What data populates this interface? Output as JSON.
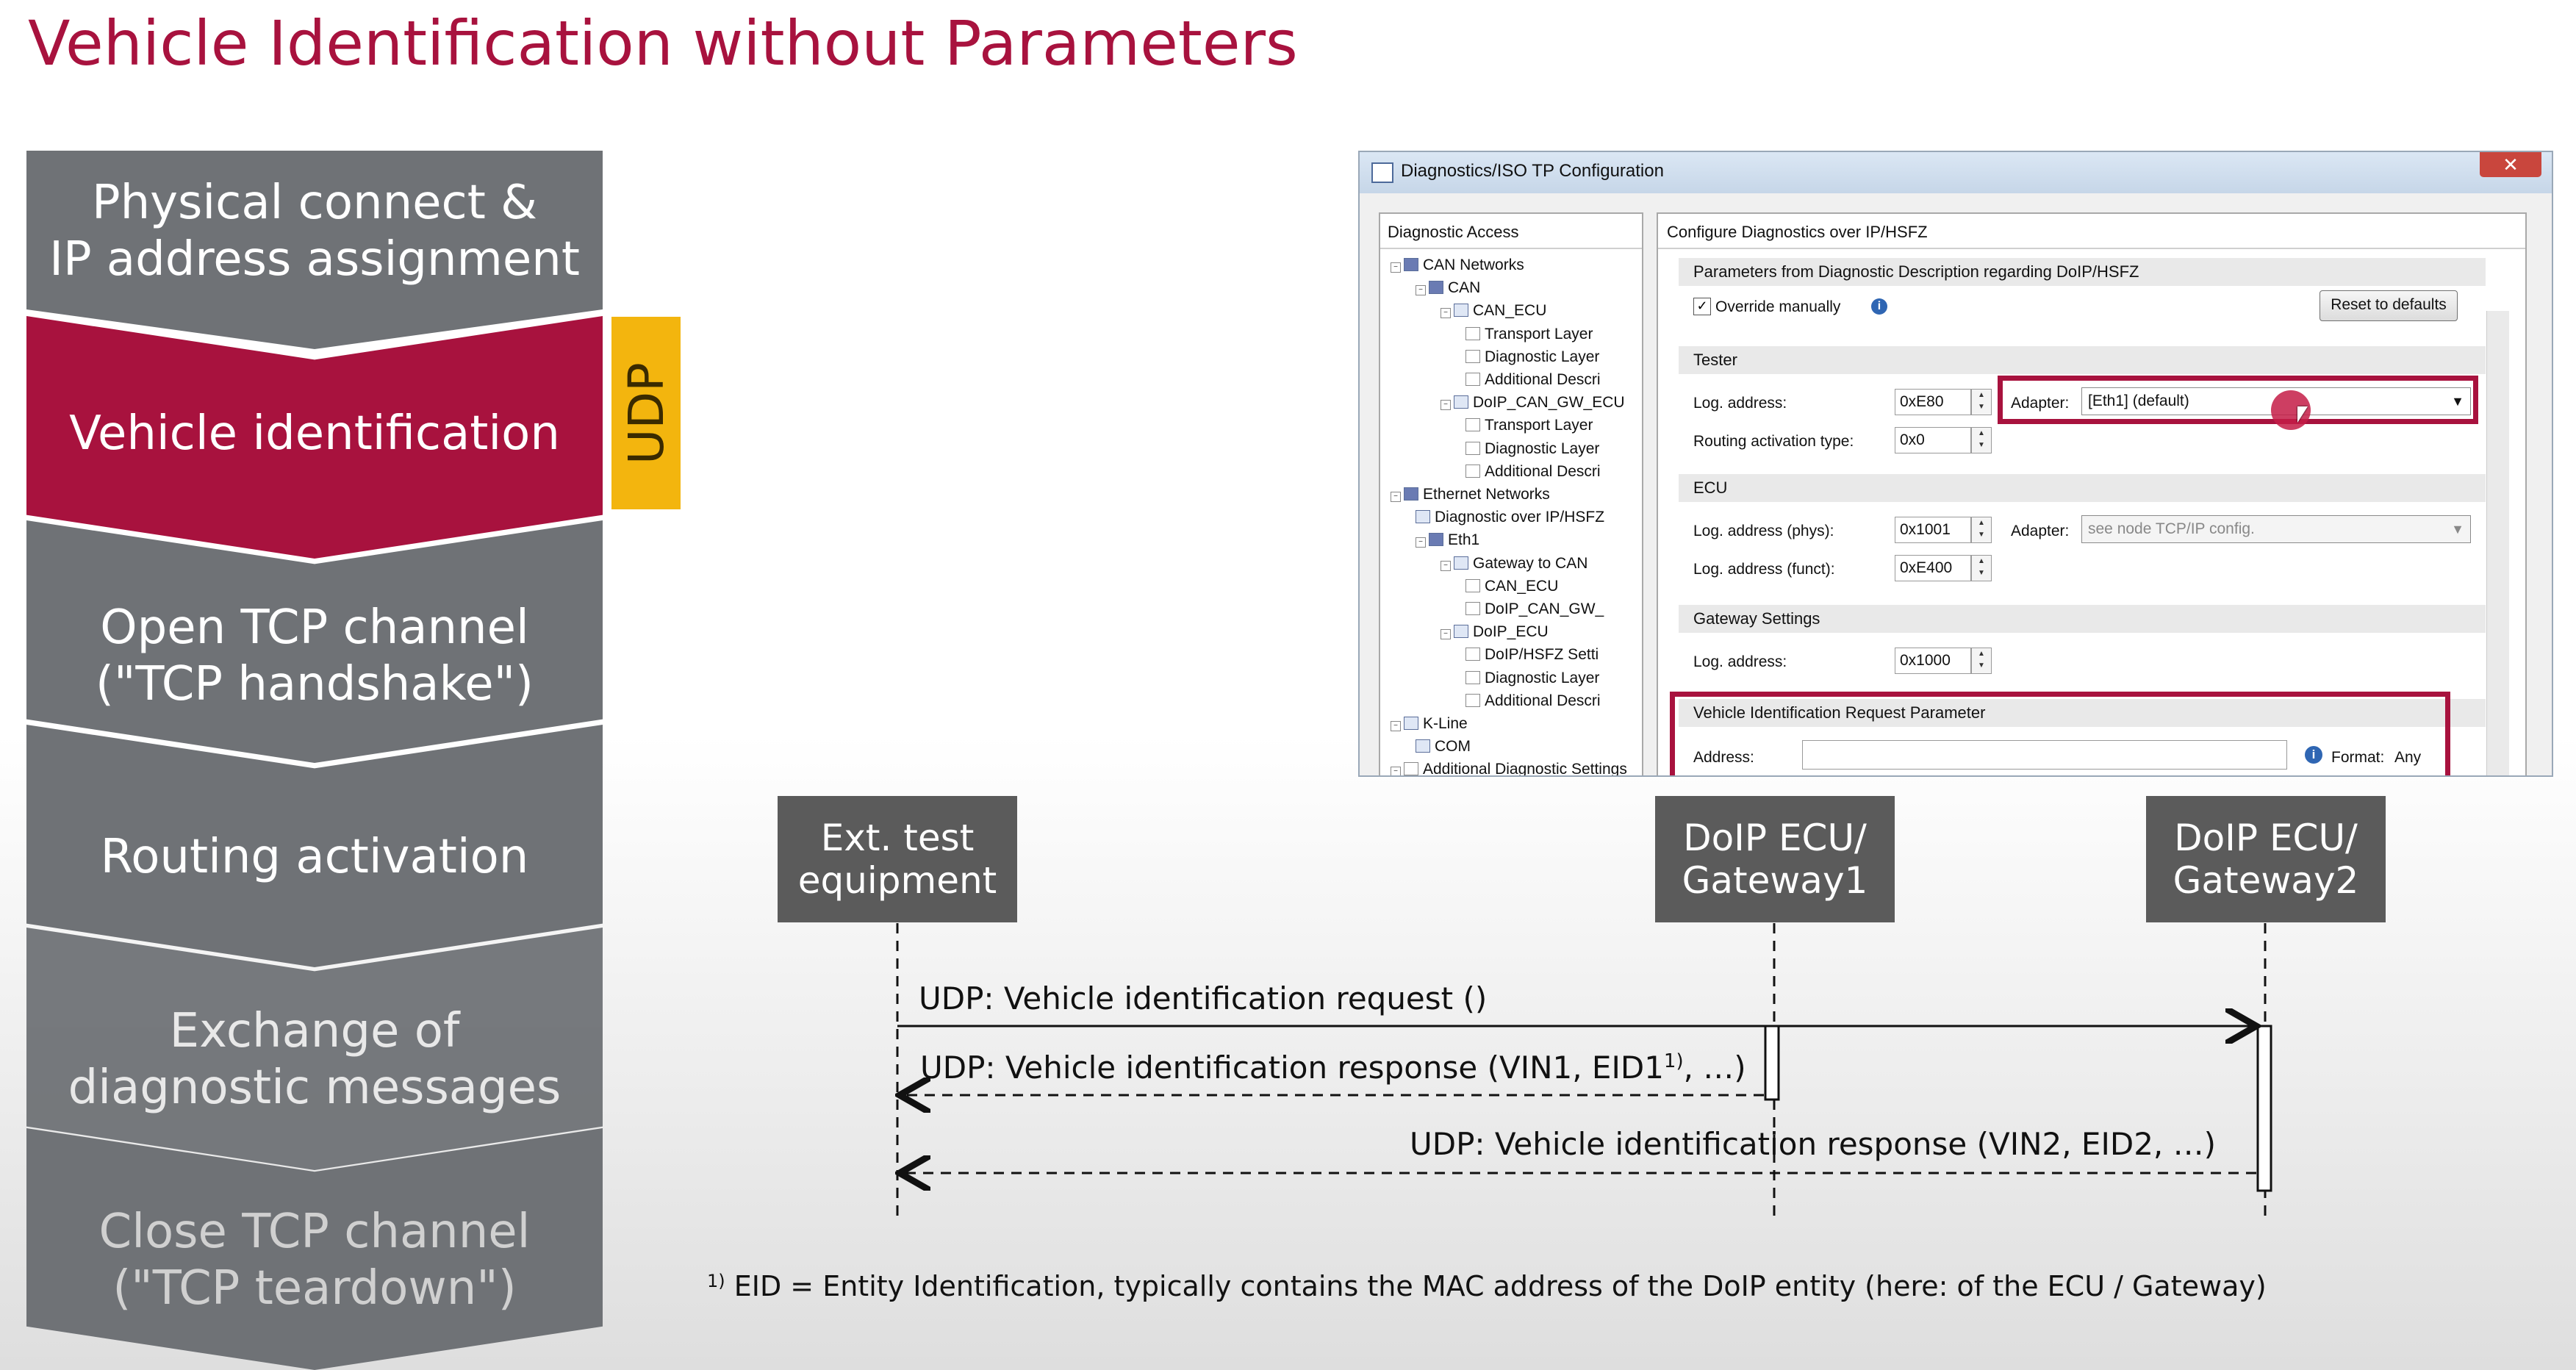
{
  "slide": {
    "title": "Vehicle Identification without Parameters",
    "steps": [
      {
        "label": "Physical connect &\nIP address assignment",
        "state": "done"
      },
      {
        "label": "Vehicle identification",
        "state": "active"
      },
      {
        "label": "Open TCP channel\n(\"TCP handshake\")",
        "state": "pending"
      },
      {
        "label": "Routing activation",
        "state": "pending"
      },
      {
        "label": "Exchange of\ndiagnostic messages",
        "state": "pending"
      },
      {
        "label": "Close TCP channel\n(\"TCP teardown\")",
        "state": "pending"
      }
    ],
    "udp_tag": "UDP",
    "colors": {
      "accent": "#a8123e",
      "udp": "#f3b50e",
      "step": "#6f7276"
    }
  },
  "window": {
    "title": "Diagnostics/ISO TP Configuration",
    "close_label": "✕",
    "left_panel": {
      "heading": "Diagnostic Access",
      "tree": [
        {
          "label": "CAN Networks",
          "indent": 0,
          "icon": "network-icon",
          "toggle": "−"
        },
        {
          "label": "CAN",
          "indent": 1,
          "icon": "network-icon",
          "toggle": "−"
        },
        {
          "label": "CAN_ECU",
          "indent": 2,
          "icon": "ecu-icon",
          "toggle": "−"
        },
        {
          "label": "Transport Layer",
          "indent": 3,
          "icon": "document-icon",
          "toggle": ""
        },
        {
          "label": "Diagnostic Layer",
          "indent": 3,
          "icon": "document-icon",
          "toggle": ""
        },
        {
          "label": "Additional Descri",
          "indent": 3,
          "icon": "document-icon",
          "toggle": ""
        },
        {
          "label": "DoIP_CAN_GW_ECU",
          "indent": 2,
          "icon": "ecu-icon",
          "toggle": "−"
        },
        {
          "label": "Transport Layer",
          "indent": 3,
          "icon": "document-icon",
          "toggle": ""
        },
        {
          "label": "Diagnostic Layer",
          "indent": 3,
          "icon": "document-icon",
          "toggle": ""
        },
        {
          "label": "Additional Descri",
          "indent": 3,
          "icon": "document-icon",
          "toggle": ""
        },
        {
          "label": "Ethernet Networks",
          "indent": 0,
          "icon": "network-icon",
          "toggle": "−"
        },
        {
          "label": "Diagnostic over IP/HSFZ",
          "indent": 1,
          "icon": "cable-icon",
          "toggle": ""
        },
        {
          "label": "Eth1",
          "indent": 1,
          "icon": "network-icon",
          "toggle": "−"
        },
        {
          "label": "Gateway to CAN",
          "indent": 2,
          "icon": "gateway-icon",
          "toggle": "−"
        },
        {
          "label": "CAN_ECU",
          "indent": 3,
          "icon": "document-icon",
          "toggle": ""
        },
        {
          "label": "DoIP_CAN_GW_",
          "indent": 3,
          "icon": "document-icon",
          "toggle": ""
        },
        {
          "label": "DoIP_ECU",
          "indent": 2,
          "icon": "ecu-icon",
          "toggle": "−"
        },
        {
          "label": "DoIP/HSFZ Setti",
          "indent": 3,
          "icon": "document-icon",
          "toggle": ""
        },
        {
          "label": "Diagnostic Layer",
          "indent": 3,
          "icon": "document-icon",
          "toggle": ""
        },
        {
          "label": "Additional Descri",
          "indent": 3,
          "icon": "document-icon",
          "toggle": ""
        },
        {
          "label": "K-Line",
          "indent": 0,
          "icon": "cable-icon",
          "toggle": "−"
        },
        {
          "label": "COM",
          "indent": 1,
          "icon": "cable-icon",
          "toggle": ""
        },
        {
          "label": "Additional Diagnostic Settings",
          "indent": 0,
          "icon": "document-icon",
          "toggle": "−"
        }
      ]
    },
    "right_panel": {
      "heading": "Configure Diagnostics over IP/HSFZ",
      "params_section": "Parameters from Diagnostic Description regarding DoIP/HSFZ",
      "override_label": "Override manually",
      "override_checked": true,
      "reset_label": "Reset to defaults",
      "tester_section": "Tester",
      "tester_log_label": "Log. address:",
      "tester_log_value": "0xE80",
      "adapter_label": "Adapter:",
      "adapter_value": "[Eth1] (default)",
      "routing_label": "Routing activation type:",
      "routing_value": "0x0",
      "ecu_section": "ECU",
      "ecu_phys_label": "Log. address (phys):",
      "ecu_phys_value": "0x1001",
      "ecu_adapter_label": "Adapter:",
      "ecu_adapter_value": "see node TCP/IP config.",
      "ecu_funct_label": "Log. address (funct):",
      "ecu_funct_value": "0xE400",
      "gateway_section": "Gateway Settings",
      "gateway_log_label": "Log. address:",
      "gateway_log_value": "0x1000",
      "vir_section": "Vehicle Identification Request Parameter",
      "address_label": "Address:",
      "address_value": "",
      "format_label": "Format:",
      "format_value": "Any"
    }
  },
  "sequence": {
    "actors": [
      {
        "label": "Ext. test\nequipment"
      },
      {
        "label": "DoIP ECU/\nGateway1"
      },
      {
        "label": "DoIP ECU/\nGateway2"
      }
    ],
    "messages": [
      "UDP: Vehicle identification request ()",
      "UDP: Vehicle identification response (VIN1, EID1",
      ", …)",
      "UDP: Vehicle identification response (VIN2, EID2, …)"
    ],
    "footnote_mark": "1)",
    "footnote": "EID = Entity Identification, typically contains the MAC address of the DoIP entity (here: of the ECU / Gateway)"
  }
}
